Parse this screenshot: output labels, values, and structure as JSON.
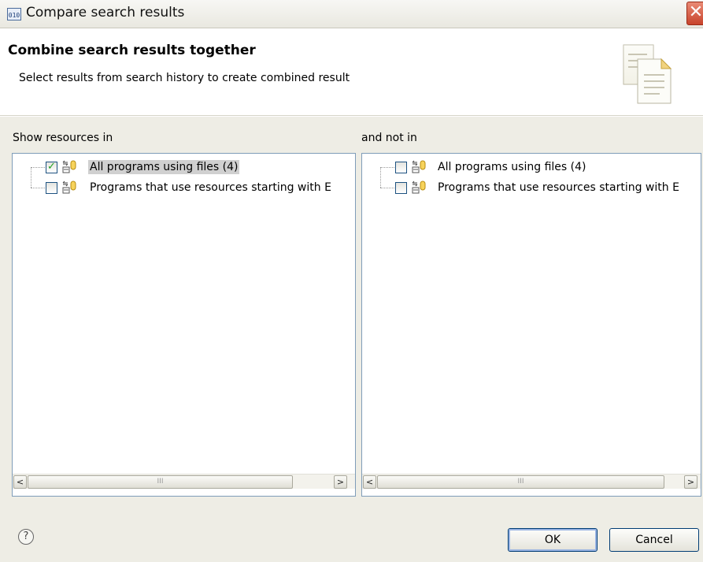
{
  "window": {
    "title": "Compare search results",
    "app_icon_text": "010"
  },
  "header": {
    "title": "Combine search results together",
    "description": "Select results from search history to create combined result"
  },
  "left_panel": {
    "label": "Show resources in",
    "items": [
      {
        "label": "All programs using files (4)",
        "checked": true,
        "selected": true
      },
      {
        "label": "Programs that use resources starting with E",
        "checked": false,
        "selected": false
      }
    ]
  },
  "right_panel": {
    "label": "and not in",
    "items": [
      {
        "label": "All programs using files (4)",
        "checked": false,
        "selected": false
      },
      {
        "label": "Programs that use resources starting with E",
        "checked": false,
        "selected": false
      }
    ]
  },
  "scrollbar": {
    "left_arrow": "<",
    "right_arrow": ">",
    "thumb_grip": "III"
  },
  "footer": {
    "help_symbol": "?",
    "ok_label": "OK",
    "cancel_label": "Cancel"
  },
  "icons": [
    "window-app-icon",
    "close-icon",
    "wizard-pages-icon",
    "search-result-icon",
    "help-icon"
  ]
}
